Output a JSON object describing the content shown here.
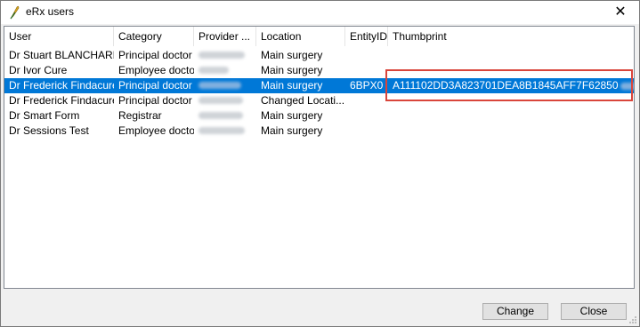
{
  "window": {
    "title": "eRx users",
    "close_glyph": "✕"
  },
  "table": {
    "columns": [
      "User",
      "Category",
      "Provider ...",
      "Location",
      "EntityID",
      "Thumbprint"
    ],
    "rows": [
      {
        "user": "Dr Stuart BLANCHARD",
        "category": "Principal doctor",
        "location": "Main surgery",
        "entity": "",
        "thumb": ""
      },
      {
        "user": "Dr Ivor Cure",
        "category": "Employee doctor",
        "location": "Main surgery",
        "entity": "",
        "thumb": ""
      },
      {
        "user": "Dr Frederick Findacure",
        "category": "Principal doctor",
        "location": "Main surgery",
        "entity": "6BPX0",
        "thumb": "A111102DD3A823701DEA8B1845AFF7F62850"
      },
      {
        "user": "Dr Frederick Findacure",
        "category": "Principal doctor",
        "location": "Changed Locati...",
        "entity": "",
        "thumb": ""
      },
      {
        "user": "Dr Smart Form",
        "category": "Registrar",
        "location": "Main surgery",
        "entity": "",
        "thumb": ""
      },
      {
        "user": "Dr Sessions Test",
        "category": "Employee doctor",
        "location": "Main surgery",
        "entity": "",
        "thumb": ""
      }
    ],
    "selected_row": 2
  },
  "buttons": {
    "change": "Change",
    "close": "Close"
  },
  "colors": {
    "selection": "#0078d7",
    "highlight_box": "#d9453b"
  }
}
